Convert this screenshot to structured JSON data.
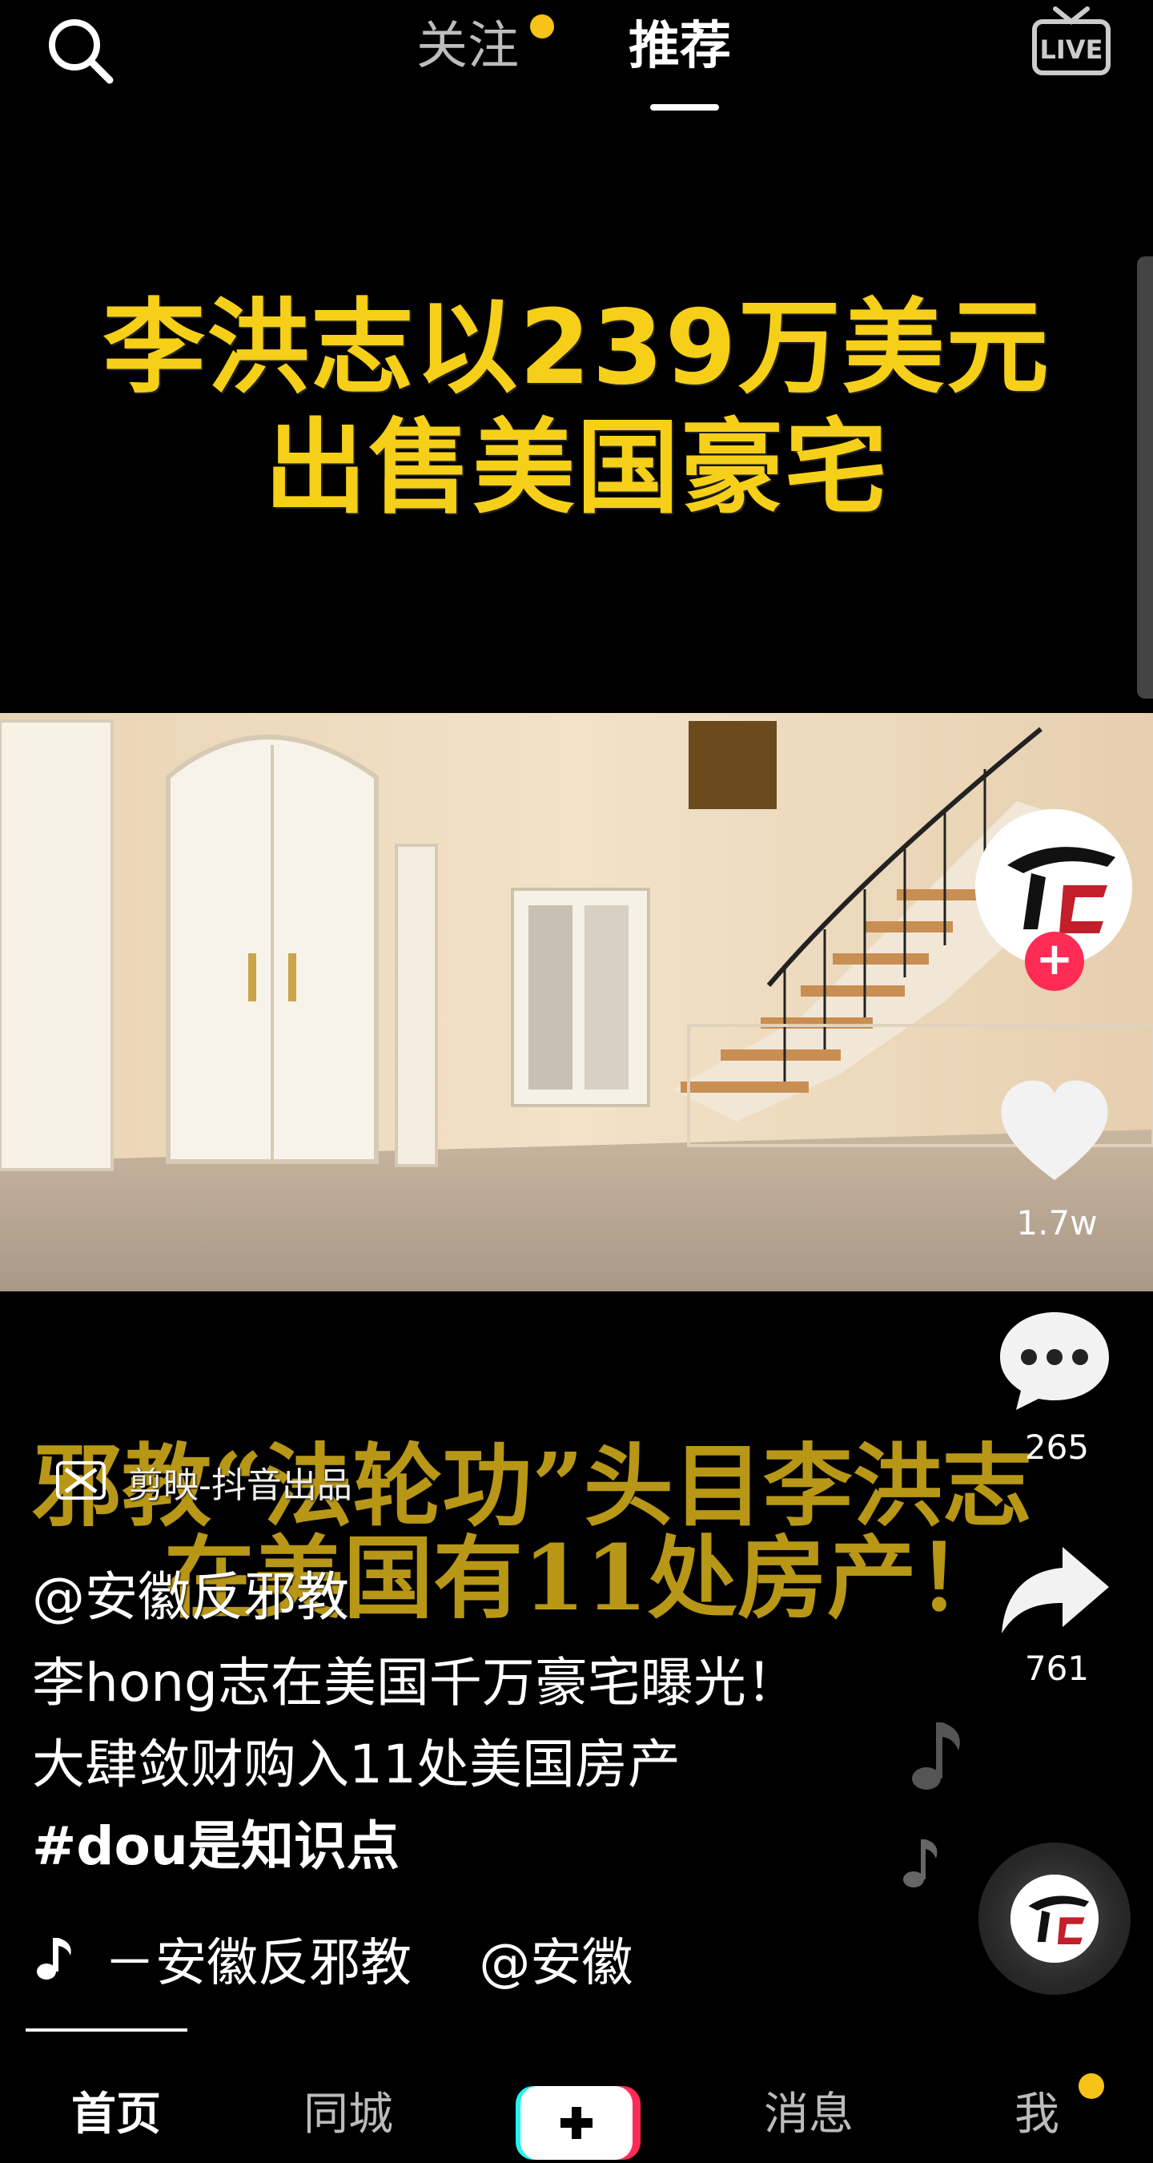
{
  "colors": {
    "accent_yellow": "#f6cf19",
    "badge_yellow": "#f7c318",
    "like_red": "#fe2c55",
    "cyan": "#25f4ee"
  },
  "top_bar": {
    "search_icon": "search-icon",
    "tabs": [
      {
        "label": "关注",
        "active": false
      },
      {
        "label": "推荐",
        "active": true
      }
    ],
    "live_icon": "live-icon"
  },
  "video": {
    "title_line1": "李洪志以239万美元",
    "title_line2": "出售美国豪宅",
    "overlay_line1": "邪教“法轮功”头目李洪志",
    "overlay_line2": "在美国有11处房产！"
  },
  "right_rail": {
    "like_count": "1.7w",
    "comment_count": "265",
    "share_count": "761"
  },
  "info": {
    "app_badge": "剪映-抖音出品",
    "author": "@安徽反邪教",
    "description": "李hong志在美国千万豪宅曝光！大肆敛财购入11处美国房产",
    "hashtag": "#dou是知识点",
    "music": "－安徽反邪教　 @安徽"
  },
  "bottom_nav": {
    "home": "首页",
    "city": "同城",
    "messages": "消息",
    "me": "我"
  }
}
